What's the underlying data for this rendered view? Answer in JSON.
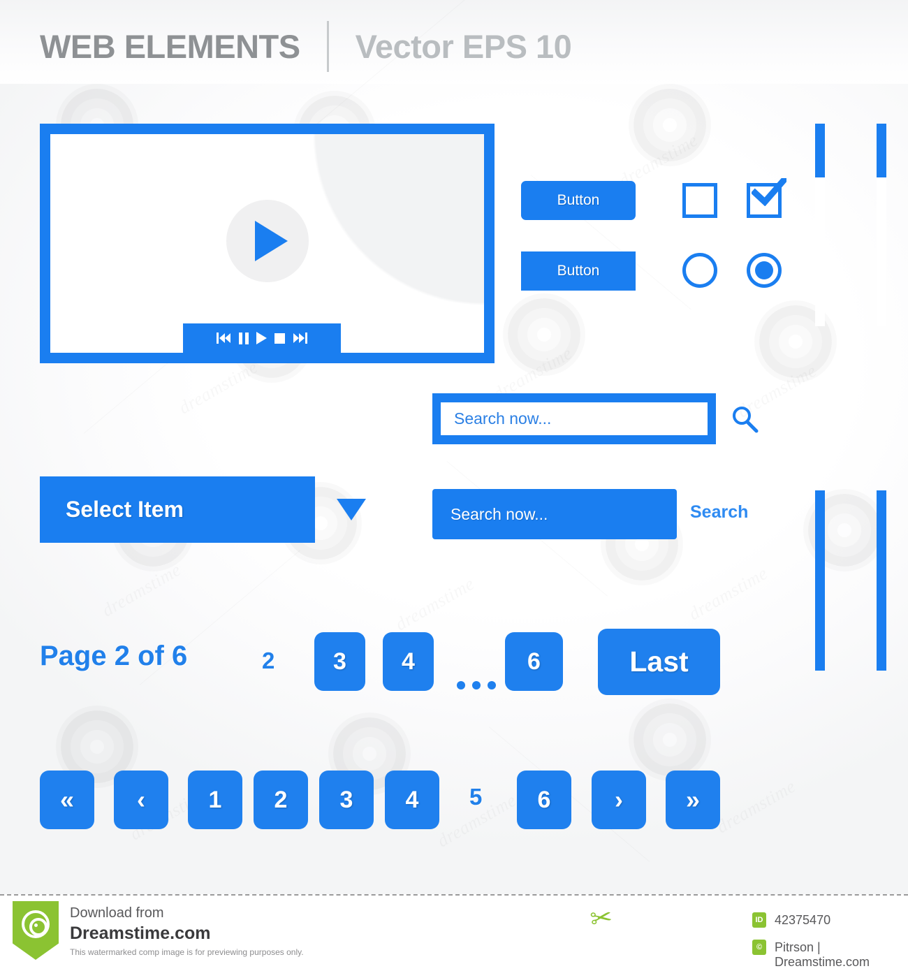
{
  "header": {
    "title": "WEB ELEMENTS",
    "subtitle": "Vector EPS 10"
  },
  "colors": {
    "accent_blue": "#1a7ef0",
    "button_blue": "#1f80ee",
    "text_blue": "#2180ea",
    "header_gray": "#8e9194",
    "header_gray_light": "#b9bdc0",
    "play_circle": "#f0f0f1",
    "footer_green": "#8bc332"
  },
  "player": {
    "controls": [
      {
        "name": "skip-back",
        "label": "Skip back"
      },
      {
        "name": "pause",
        "label": "Pause"
      },
      {
        "name": "play",
        "label": "Play"
      },
      {
        "name": "stop",
        "label": "Stop"
      },
      {
        "name": "skip-forward",
        "label": "Skip forward"
      }
    ],
    "center_play_label": "Play"
  },
  "buttons": {
    "rounded_label": "Button",
    "square_label": "Button"
  },
  "controls": {
    "checkbox_unchecked": false,
    "checkbox_checked": true,
    "radio_unselected": false,
    "radio_selected": true
  },
  "search_framed": {
    "value": "Search now...",
    "placeholder": "Search now...",
    "icon": "search-icon"
  },
  "search_solid": {
    "value": "Search now...",
    "placeholder": "Search now...",
    "action_label": "Search"
  },
  "select": {
    "selected_label": "Select Item",
    "caret": "chevron-down-icon"
  },
  "pagination_top": {
    "status_label": "Page 2 of 6",
    "plain_prev": "2",
    "buttons": [
      "3",
      "4"
    ],
    "ellipsis": "...",
    "last_number": "6",
    "last_label": "Last"
  },
  "pagination_bottom": {
    "first_icon": "«",
    "prev_icon": "‹",
    "numbers": [
      "1",
      "2",
      "3",
      "4"
    ],
    "current": "5",
    "after_current": "6",
    "next_icon": "›",
    "last_icon": "»"
  },
  "scrollbars": [
    {
      "name": "scrollbar-top-left",
      "thumb_position": "top"
    },
    {
      "name": "scrollbar-top-right",
      "thumb_position": "top"
    },
    {
      "name": "scrollbar-bottom-left",
      "thumb_position": "full"
    },
    {
      "name": "scrollbar-bottom-right",
      "thumb_position": "full"
    }
  ],
  "footer": {
    "download_from": "Download from",
    "site": "Dreamstime.com",
    "note": "This watermarked comp image is for previewing purposes only.",
    "id_badge": "ID",
    "id_value": "42375470",
    "copyright_badge": "©",
    "copyright_value": "Pitrson | Dreamstime.com",
    "scissors_icon": "✂"
  }
}
